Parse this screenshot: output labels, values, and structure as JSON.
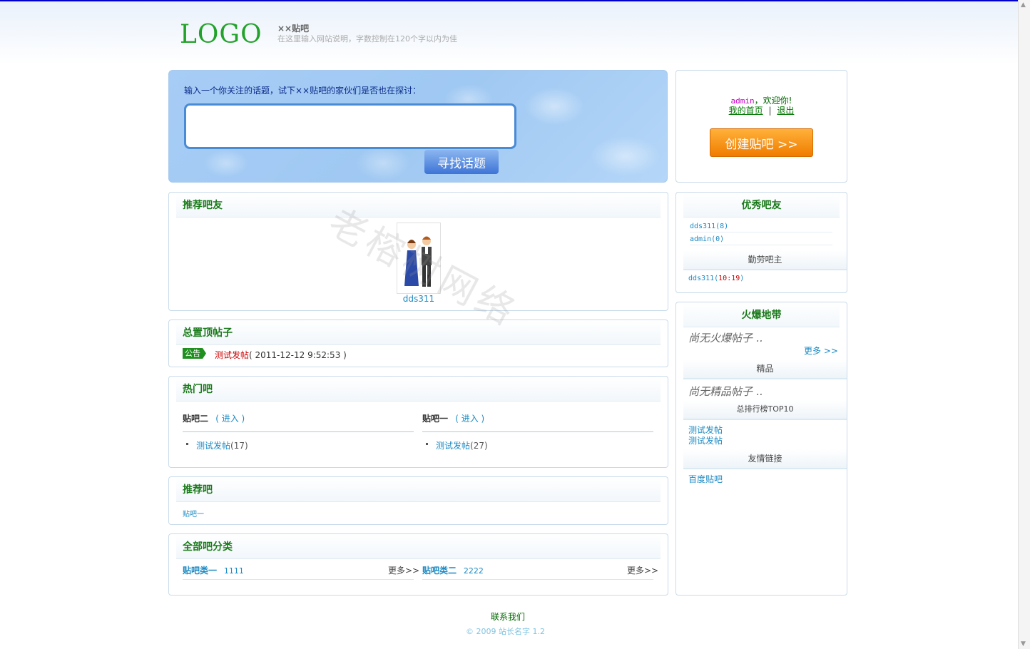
{
  "header": {
    "logo_text": "LOGO",
    "site_name": "××贴吧",
    "site_desc": "在这里输入网站说明，字数控制在120个字以内为佳"
  },
  "search": {
    "prompt": "输入一个你关注的话题，试下××贴吧的家伙们是否也在探讨：",
    "value": "",
    "button": "寻找话题"
  },
  "user_panel": {
    "username": "admin",
    "welcome": "，欢迎你!",
    "home_link": "我的首页",
    "separator": "|",
    "logout_link": "退出",
    "create_button": "创建贴吧 >>"
  },
  "recommended_friends": {
    "title": "推荐吧友",
    "friends": [
      {
        "name": "dds311"
      }
    ]
  },
  "sticky_posts": {
    "title": "总置顶帖子",
    "tag": "公告",
    "post_title": "测试发帖",
    "post_time": "( 2011-12-12 9:52:53 )"
  },
  "hot_bars": {
    "title": "热门吧",
    "columns": [
      {
        "name": "贴吧二",
        "enter": "( 进入 )",
        "posts": [
          {
            "title": "测试发帖",
            "count": "(17)"
          }
        ]
      },
      {
        "name": "贴吧一",
        "enter": "( 进入 )",
        "posts": [
          {
            "title": "测试发帖",
            "count": "(27)"
          }
        ]
      }
    ]
  },
  "recommended_bars": {
    "title": "推荐吧",
    "bars": [
      "贴吧一"
    ]
  },
  "categories": {
    "title": "全部吧分类",
    "items": [
      {
        "name": "贴吧类一",
        "sub": "1111",
        "more": "更多>>"
      },
      {
        "name": "贴吧类二",
        "sub": "2222",
        "more": "更多>>"
      }
    ]
  },
  "top_friends": {
    "title": "优秀吧友",
    "list": [
      {
        "name": "dds311",
        "count": "(8)"
      },
      {
        "name": "admin",
        "count": "(0)"
      }
    ],
    "diligent_title": "勤劳吧主",
    "diligent": {
      "name": "dds311",
      "open": "(",
      "value": "10:19",
      "close": ")"
    }
  },
  "hot_zone": {
    "title": "火爆地带",
    "empty_hot": "尚无火爆帖子 ..",
    "more": "更多 >>",
    "elite_title": "精品",
    "empty_elite": "尚无精品帖子 ..",
    "top10_title": "总排行榜TOP10",
    "top10": [
      "测试发帖",
      "测试发帖"
    ],
    "links_title": "友情链接",
    "links": [
      "百度贴吧"
    ]
  },
  "footer": {
    "contact": "联系我们",
    "copyright": "© 2009 站长名字 1.2"
  },
  "watermark": "老榕树网络"
}
